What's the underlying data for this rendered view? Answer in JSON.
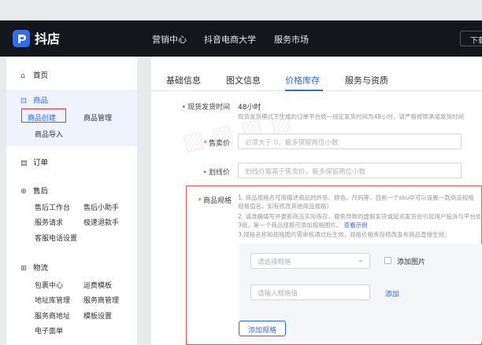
{
  "topbar": {
    "logo_text": "抖店",
    "nav": [
      "营销中心",
      "抖音电商大学",
      "服务市场"
    ],
    "right_button": "下载"
  },
  "sidebar": {
    "home": "首页",
    "groups": [
      {
        "title": "商品",
        "items": [
          "商品创建",
          "商品管理",
          "商品导入"
        ]
      },
      {
        "title": "订单",
        "items": []
      },
      {
        "title": "售后",
        "items": [
          "售后工作台",
          "售后小助手",
          "服务请求",
          "极速退款手",
          "客服电话设置"
        ]
      },
      {
        "title": "物流",
        "items": [
          "包裹中心",
          "运费模板",
          "地址库管理",
          "服务商管理",
          "服务商地址",
          "模板设置",
          "电子面单"
        ]
      }
    ]
  },
  "tabs": [
    "基础信息",
    "图文信息",
    "价格库存",
    "服务与资质"
  ],
  "form": {
    "ship_time": {
      "label": "现货发货时间",
      "value": "48小时",
      "hint": "现货发货模式下生成的订单平台统一规定发货时间为48小时，请严格按照承诺发货时间"
    },
    "sale_price": {
      "label": "售卖价",
      "placeholder": "必须大于 0，最多保留两位小数"
    },
    "strike_price": {
      "label": "划线价",
      "placeholder": "划线价需高于售卖价，最多保留两位小数"
    },
    "spec": {
      "label": "商品规格",
      "hint1": "1. 商品规格名可用描述商品的外形、颜色、尺码等，目前一个sku中可以设置一款商品规格",
      "hint1b": "规格值名，如有修改其他商品规格）",
      "hint2": "2. 请准确填写并更新商品实际库存，避免导致的虚假发货或延迟发货会引起用户投诉与平台处罚",
      "hint2b": "3组，第一个商品规格可添加规格图片。",
      "hint2_link": "查看示例",
      "hint3": "3.规格名称和规格图片需审核通过后生效，规格价格库存修改发布商品直接生效。",
      "select_placeholder": "请选择规格",
      "add_image": "添加图片",
      "value_placeholder": "请输入规格值",
      "add_link": "添加",
      "add_spec_button": "添加规格"
    }
  },
  "colors": {
    "accent": "#2e6cf6",
    "highlight": "#e23b3b",
    "topbar": "#15161c"
  }
}
